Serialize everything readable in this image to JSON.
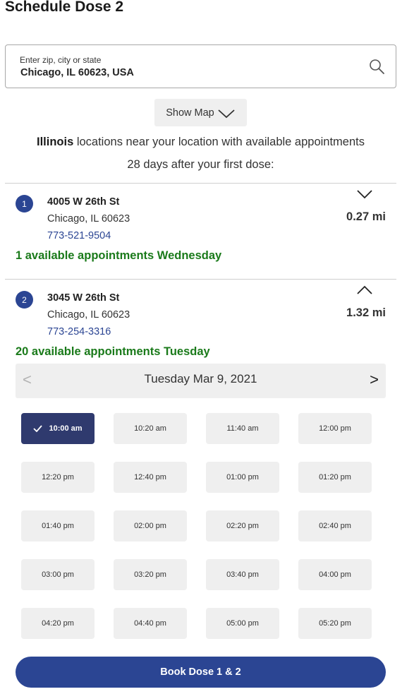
{
  "page": {
    "title": "Schedule Dose 2"
  },
  "search": {
    "label": "Enter zip, city or state",
    "value": "Chicago, IL 60623, USA",
    "icon": "search-icon"
  },
  "map_toggle": {
    "label": "Show Map",
    "icon": "chevron-down-icon"
  },
  "intro": {
    "state": "Illinois",
    "line1_rest": " locations near your location with available appointments",
    "line2": "28 days after your first dose:"
  },
  "locations": [
    {
      "number": "1",
      "street": "4005 W 26th St",
      "city": "Chicago, IL 60623",
      "phone": "773-521-9504",
      "availability": "1 available appointments Wednesday",
      "distance": "0.27 mi",
      "expanded": false
    },
    {
      "number": "2",
      "street": "3045 W 26th St",
      "city": "Chicago, IL 60623",
      "phone": "773-254-3316",
      "availability": "20 available appointments Tuesday",
      "distance": "1.32 mi",
      "expanded": true
    }
  ],
  "calendar": {
    "prev_label": "<",
    "next_label": ">",
    "date_label": "Tuesday Mar 9, 2021"
  },
  "slots": [
    "10:00 am",
    "10:20 am",
    "11:40 am",
    "12:00 pm",
    "12:20 pm",
    "12:40 pm",
    "01:00 pm",
    "01:20 pm",
    "01:40 pm",
    "02:00 pm",
    "02:20 pm",
    "02:40 pm",
    "03:00 pm",
    "03:20 pm",
    "03:40 pm",
    "04:00 pm",
    "04:20 pm",
    "04:40 pm",
    "05:00 pm",
    "05:20 pm"
  ],
  "selected_slot": "10:00 am",
  "book": {
    "label": "Book Dose 1 & 2"
  },
  "colors": {
    "primary": "#2b4593",
    "selected": "#2f3a6e",
    "available": "#1a7a1a",
    "slot_bg": "#efefef"
  }
}
